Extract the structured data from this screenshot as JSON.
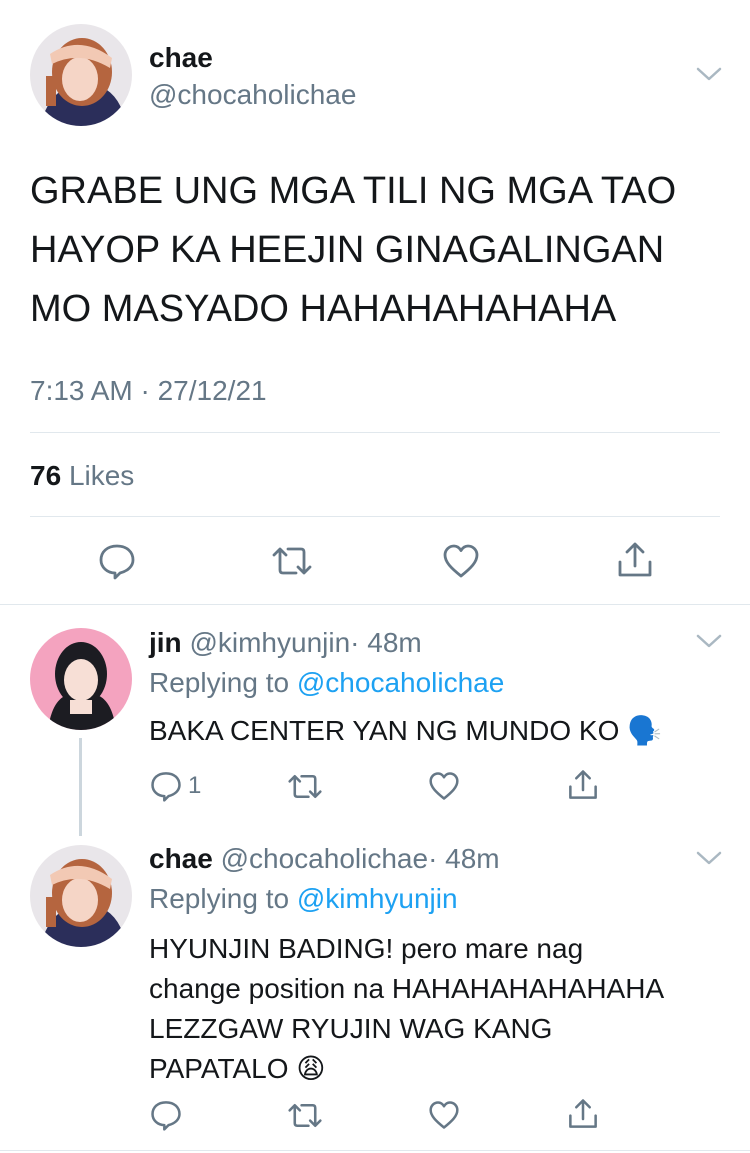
{
  "main_tweet": {
    "author_name": "chae",
    "author_handle": "@chocaholichae",
    "text_lines": [
      "GRABE UNG MGA TILI NG MGA TAO",
      "HAYOP KA HEEJIN GINAGALINGAN",
      "MO MASYADO HAHAHAHAHAHA"
    ],
    "timestamp": "7:13 AM · 27/12/21",
    "likes_count": "76",
    "likes_label": "Likes"
  },
  "replies": [
    {
      "author_name": "jin",
      "author_handle": "@kimhyunjin",
      "time": "· 48m",
      "replying_prefix": "Replying to",
      "replying_to": "@chocaholichae",
      "text_lines": [
        "BAKA CENTER YAN NG MUNDO KO 🗣️"
      ],
      "reply_count": "1"
    },
    {
      "author_name": "chae",
      "author_handle": "@chocaholichae",
      "time": "· 48m",
      "replying_prefix": "Replying to",
      "replying_to": "@kimhyunjin",
      "text_lines": [
        "HYUNJIN BADING! pero mare nag",
        "change position na HAHAHAHAHAHAHA",
        "LEZZGAW RYUJIN WAG KANG",
        "PAPATALO 😩"
      ],
      "reply_count": ""
    }
  ],
  "icons": {
    "reply": "reply-icon",
    "retweet": "retweet-icon",
    "like": "heart-icon",
    "share": "share-icon",
    "menu": "chevron-down-icon"
  },
  "colors": {
    "text": "#14171a",
    "secondary": "#657786",
    "link": "#1da1f2",
    "divider": "#e1e8ed"
  }
}
